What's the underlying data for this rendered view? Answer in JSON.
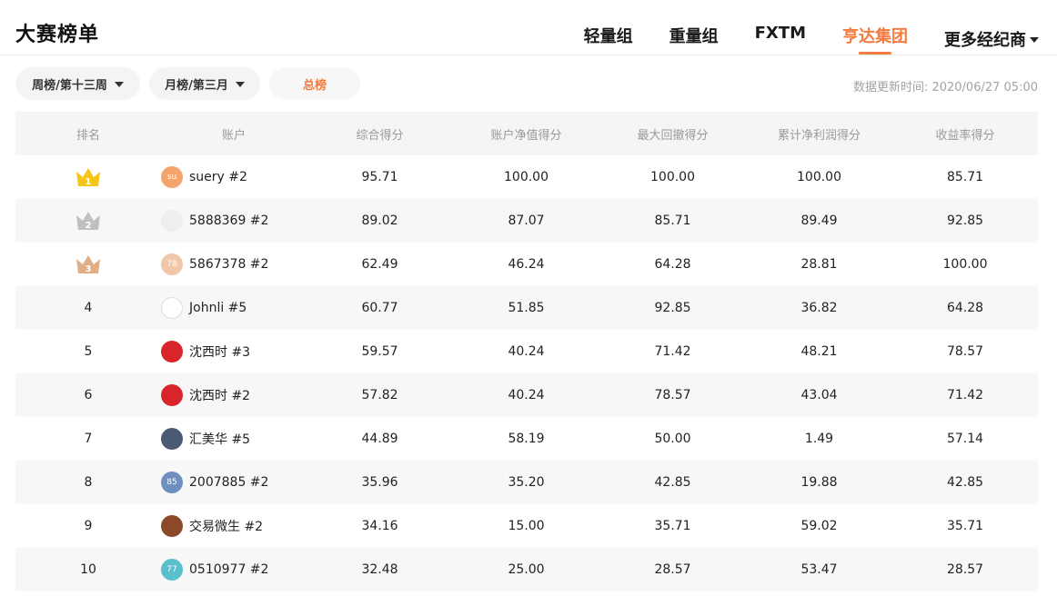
{
  "header": {
    "title": "大赛榜单",
    "tabs": [
      {
        "label": "轻量组",
        "active": false
      },
      {
        "label": "重量组",
        "active": false
      },
      {
        "label": "FXTM",
        "active": false
      },
      {
        "label": "亨达集团",
        "active": true
      },
      {
        "label": "更多经纪商",
        "active": false,
        "dropdown": true
      }
    ]
  },
  "filters": {
    "week": "周榜/第十三周",
    "month": "月榜/第三月",
    "total": "总榜"
  },
  "update_time": "数据更新时间: 2020/06/27 05:00",
  "colors": {
    "accent": "#f47b3f",
    "gold": "#f5c518",
    "silver": "#c0c0c0",
    "bronze": "#e0ad84"
  },
  "table": {
    "headers": [
      "排名",
      "账户",
      "综合得分",
      "账户净值得分",
      "最大回撤得分",
      "累计净利润得分",
      "收益率得分"
    ],
    "rows": [
      {
        "rank": "1",
        "medal": "gold",
        "avatar": {
          "text": "su",
          "color": "#f4a46a"
        },
        "name": "suery #2",
        "s1": "95.71",
        "s2": "100.00",
        "s3": "100.00",
        "s4": "100.00",
        "s5": "85.71"
      },
      {
        "rank": "2",
        "medal": "silver",
        "avatar": {
          "text": "",
          "color": "#eeeeee"
        },
        "name": "5888369 #2",
        "s1": "89.02",
        "s2": "87.07",
        "s3": "85.71",
        "s4": "89.49",
        "s5": "92.85"
      },
      {
        "rank": "3",
        "medal": "bronze",
        "avatar": {
          "text": "78",
          "color": "#f1c7aa"
        },
        "name": "5867378 #2",
        "s1": "62.49",
        "s2": "46.24",
        "s3": "64.28",
        "s4": "28.81",
        "s5": "100.00"
      },
      {
        "rank": "4",
        "medal": "",
        "avatar": {
          "text": "",
          "color": "#ffffff"
        },
        "name": "Johnli #5",
        "s1": "60.77",
        "s2": "51.85",
        "s3": "92.85",
        "s4": "36.82",
        "s5": "64.28"
      },
      {
        "rank": "5",
        "medal": "",
        "avatar": {
          "text": "",
          "color": "#d7252b"
        },
        "name": "沈西时 #3",
        "s1": "59.57",
        "s2": "40.24",
        "s3": "71.42",
        "s4": "48.21",
        "s5": "78.57"
      },
      {
        "rank": "6",
        "medal": "",
        "avatar": {
          "text": "",
          "color": "#d7252b"
        },
        "name": "沈西时 #2",
        "s1": "57.82",
        "s2": "40.24",
        "s3": "78.57",
        "s4": "43.04",
        "s5": "71.42"
      },
      {
        "rank": "7",
        "medal": "",
        "avatar": {
          "text": "",
          "color": "#4a5a73"
        },
        "name": "汇美华 #5",
        "s1": "44.89",
        "s2": "58.19",
        "s3": "50.00",
        "s4": "1.49",
        "s5": "57.14"
      },
      {
        "rank": "8",
        "medal": "",
        "avatar": {
          "text": "85",
          "color": "#6f8fc0"
        },
        "name": "2007885 #2",
        "s1": "35.96",
        "s2": "35.20",
        "s3": "42.85",
        "s4": "19.88",
        "s5": "42.85"
      },
      {
        "rank": "9",
        "medal": "",
        "avatar": {
          "text": "",
          "color": "#8a4a2a"
        },
        "name": "交易微生 #2",
        "s1": "34.16",
        "s2": "15.00",
        "s3": "35.71",
        "s4": "59.02",
        "s5": "35.71"
      },
      {
        "rank": "10",
        "medal": "",
        "avatar": {
          "text": "77",
          "color": "#5bbecb"
        },
        "name": "0510977 #2",
        "s1": "32.48",
        "s2": "25.00",
        "s3": "28.57",
        "s4": "53.47",
        "s5": "28.57"
      }
    ]
  }
}
